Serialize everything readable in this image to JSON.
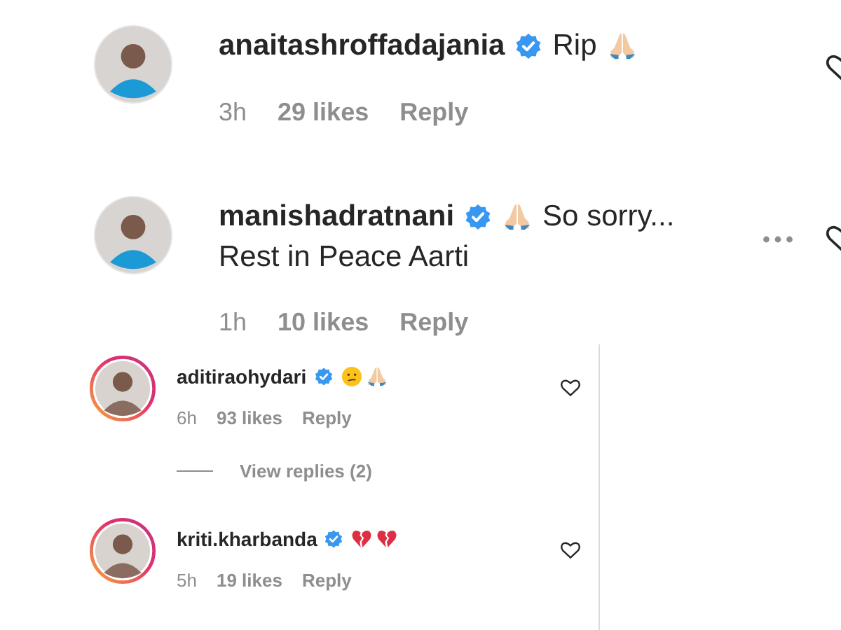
{
  "main_comments": [
    {
      "username": "anaitashroffadajania",
      "verified": true,
      "story_ring": false,
      "parts": [
        {
          "kind": "text",
          "text": "Rip"
        },
        {
          "kind": "praying-hands"
        }
      ],
      "more": false,
      "time": "3h",
      "likes": "29 likes",
      "reply": "Reply"
    },
    {
      "username": "manishadratnani",
      "verified": true,
      "story_ring": false,
      "parts": [
        {
          "kind": "praying-hands"
        },
        {
          "kind": "text",
          "text": "So sorry..."
        }
      ],
      "more": true,
      "continuation": "Rest in Peace Aarti",
      "time": "1h",
      "likes": "10 likes",
      "reply": "Reply"
    }
  ],
  "panel_comments": [
    {
      "username": "aditiraohydari",
      "verified": true,
      "story_ring": true,
      "parts": [
        {
          "kind": "confused-face"
        },
        {
          "kind": "praying-hands"
        }
      ],
      "time": "6h",
      "likes": "93 likes",
      "reply": "Reply",
      "view_replies": "View replies (2)"
    },
    {
      "username": "kriti.kharbanda",
      "verified": true,
      "story_ring": true,
      "parts": [
        {
          "kind": "broken-heart"
        },
        {
          "kind": "broken-heart"
        }
      ],
      "time": "5h",
      "likes": "19 likes",
      "reply": "Reply"
    }
  ]
}
